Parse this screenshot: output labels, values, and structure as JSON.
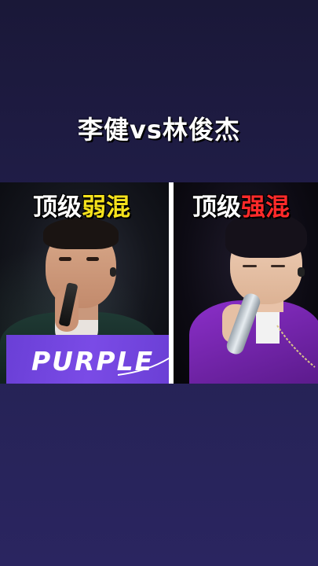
{
  "title": "李健vs林俊杰",
  "left_panel": {
    "tag_part1": "顶级",
    "tag_part2": "弱混",
    "banner_text": "PURPLE"
  },
  "right_panel": {
    "tag_part1": "顶级",
    "tag_part2": "强混"
  }
}
